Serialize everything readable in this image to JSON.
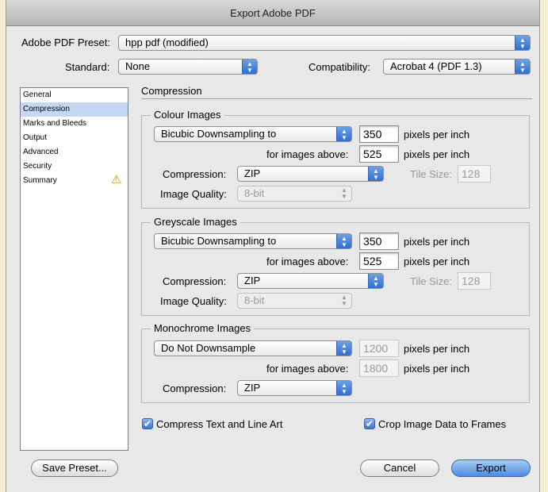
{
  "window": {
    "title": "Export Adobe PDF"
  },
  "preset": {
    "label": "Adobe PDF Preset:",
    "value": "hpp pdf (modified)"
  },
  "standard": {
    "label": "Standard:",
    "value": "None"
  },
  "compatibility": {
    "label": "Compatibility:",
    "value": "Acrobat 4 (PDF 1.3)"
  },
  "sidebar": {
    "items": [
      {
        "label": "General"
      },
      {
        "label": "Compression"
      },
      {
        "label": "Marks and Bleeds"
      },
      {
        "label": "Output"
      },
      {
        "label": "Advanced"
      },
      {
        "label": "Security"
      },
      {
        "label": "Summary"
      }
    ]
  },
  "section": {
    "title": "Compression"
  },
  "colour": {
    "title": "Colour Images",
    "downsample": "Bicubic Downsampling to",
    "ppi": "350",
    "ppi_unit": "pixels per inch",
    "above_label": "for images above:",
    "above": "525",
    "above_unit": "pixels per inch",
    "compression_label": "Compression:",
    "compression": "ZIP",
    "tile_label": "Tile Size:",
    "tile": "128",
    "quality_label": "Image Quality:",
    "quality": "8-bit"
  },
  "grey": {
    "title": "Greyscale Images",
    "downsample": "Bicubic Downsampling to",
    "ppi": "350",
    "ppi_unit": "pixels per inch",
    "above_label": "for images above:",
    "above": "525",
    "above_unit": "pixels per inch",
    "compression_label": "Compression:",
    "compression": "ZIP",
    "tile_label": "Tile Size:",
    "tile": "128",
    "quality_label": "Image Quality:",
    "quality": "8-bit"
  },
  "mono": {
    "title": "Monochrome Images",
    "downsample": "Do Not Downsample",
    "ppi": "1200",
    "ppi_unit": "pixels per inch",
    "above_label": "for images above:",
    "above": "1800",
    "above_unit": "pixels per inch",
    "compression_label": "Compression:",
    "compression": "ZIP"
  },
  "options": {
    "compress_text": {
      "label": "Compress Text and Line Art",
      "checked": true
    },
    "crop_image": {
      "label": "Crop Image Data to Frames",
      "checked": true
    }
  },
  "buttons": {
    "save_preset": "Save Preset...",
    "cancel": "Cancel",
    "export": "Export"
  },
  "icons": {
    "checkmark": "✔",
    "warning": "⚠",
    "popup_arrows": "▲▼"
  },
  "colors": {
    "accent": "#3b76d0",
    "selection": "#c3d8f2"
  }
}
